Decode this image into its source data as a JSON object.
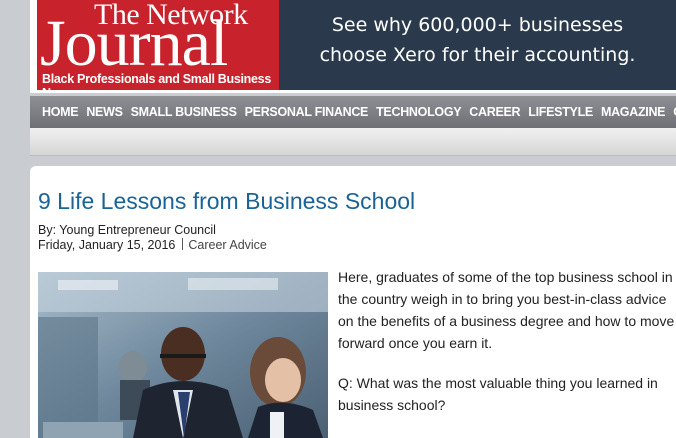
{
  "header": {
    "logo": {
      "line1": "The Network",
      "line2": "Journal",
      "tagline": "Black Professionals and Small Business News"
    },
    "ad": {
      "line1": "See why 600,000+ businesses",
      "line2": "choose Xero for their accounting."
    }
  },
  "nav": {
    "items": [
      "HOME",
      "NEWS",
      "SMALL BUSINESS",
      "PERSONAL FINANCE",
      "TECHNOLOGY",
      "CAREER",
      "LIFESTYLE",
      "MAGAZINE",
      "C"
    ]
  },
  "article": {
    "title": "9 Life Lessons from Business School",
    "byline": "By: Young Entrepreneur Council",
    "date": "Friday, January 15, 2016",
    "category": "Career Advice",
    "paragraphs": [
      "Here, graduates of some of the top business school in the country weigh in to bring you best-in-class advice on the benefits of a business degree and how to move forward once you earn it.",
      "Q: What was the most valuable thing you learned in business school?"
    ]
  }
}
